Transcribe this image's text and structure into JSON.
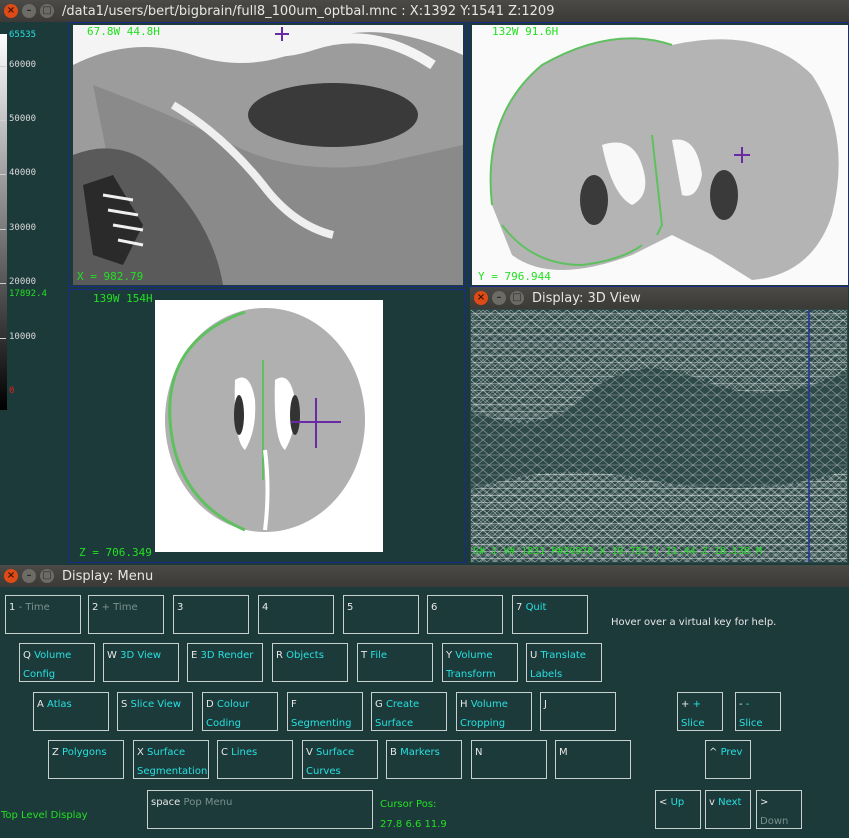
{
  "main_window": {
    "title": "/data1/users/bert/bigbrain/full8_100um_optbal.mnc : X:1392 Y:1541 Z:1209",
    "buttons": [
      "×",
      "–",
      "□"
    ]
  },
  "colorbar": {
    "labels": [
      "65535",
      "60000",
      "50000",
      "40000",
      "30000",
      "20000",
      "17892.4",
      "10000",
      "0"
    ]
  },
  "views": {
    "sagittal": {
      "dims": "67.8W  44.8H",
      "coord": "X =  982.79"
    },
    "coronal": {
      "dims": "132W  91.6H",
      "coord": "Y =  796.944"
    },
    "axial": {
      "dims": "139W  154H",
      "coord": "Z =  706.349"
    }
  },
  "view3d": {
    "title": "Display: 3D View",
    "buttons": [
      "×",
      "–",
      "□"
    ],
    "status": "S# 1 V# 1831 P#20970 X 19.752 Y 11.44 Z 18.138 M"
  },
  "menu": {
    "title": "Display: Menu",
    "buttons": [
      "×",
      "–",
      "□"
    ],
    "help": "Hover over a virtual key for help.",
    "top_level": "Top Level Display",
    "cursor_label": "Cursor Pos:",
    "cursor_value": "27.8 6.6 11.9",
    "keys": {
      "k1": {
        "key": "1",
        "l1": "- Time",
        "l2": ""
      },
      "k2": {
        "key": "2",
        "l1": "+ Time",
        "l2": ""
      },
      "k3": {
        "key": "3",
        "l1": "",
        "l2": ""
      },
      "k4": {
        "key": "4",
        "l1": "",
        "l2": ""
      },
      "k5": {
        "key": "5",
        "l1": "",
        "l2": ""
      },
      "k6": {
        "key": "6",
        "l1": "",
        "l2": ""
      },
      "k7": {
        "key": "7",
        "l1": "Quit",
        "l2": ""
      },
      "kq": {
        "key": "Q",
        "l1": "Volume",
        "l2": "Config"
      },
      "kw": {
        "key": "W",
        "l1": "3D View",
        "l2": ""
      },
      "ke": {
        "key": "E",
        "l1": "3D Render",
        "l2": ""
      },
      "kr": {
        "key": "R",
        "l1": "Objects",
        "l2": ""
      },
      "kt": {
        "key": "T",
        "l1": "File",
        "l2": ""
      },
      "ky": {
        "key": "Y",
        "l1": "Volume",
        "l2": "Transform"
      },
      "ku": {
        "key": "U",
        "l1": "Translate",
        "l2": "Labels"
      },
      "ka": {
        "key": "A",
        "l1": "Atlas",
        "l2": ""
      },
      "ks": {
        "key": "S",
        "l1": "Slice View",
        "l2": ""
      },
      "kd": {
        "key": "D",
        "l1": "Colour",
        "l2": "Coding"
      },
      "kf": {
        "key": "F",
        "l1": "Segmenting",
        "l2": ""
      },
      "kg": {
        "key": "G",
        "l1": "Create",
        "l2": "Surface"
      },
      "kh": {
        "key": "H",
        "l1": "Volume",
        "l2": "Cropping"
      },
      "kj": {
        "key": "J",
        "l1": "",
        "l2": ""
      },
      "kplus": {
        "key": "+",
        "l1": "+",
        "l2": "Slice"
      },
      "kminus": {
        "key": "-",
        "l1": "-",
        "l2": "Slice"
      },
      "kz": {
        "key": "Z",
        "l1": "Polygons",
        "l2": ""
      },
      "kx": {
        "key": "X",
        "l1": "Surface",
        "l2": "Segmentation"
      },
      "kc": {
        "key": "C",
        "l1": "Lines",
        "l2": ""
      },
      "kv": {
        "key": "V",
        "l1": "Surface",
        "l2": "Curves"
      },
      "kb": {
        "key": "B",
        "l1": "Markers",
        "l2": ""
      },
      "kn": {
        "key": "N",
        "l1": "",
        "l2": ""
      },
      "km": {
        "key": "M",
        "l1": "",
        "l2": ""
      },
      "kprev": {
        "key": "^",
        "l1": "Prev",
        "l2": ""
      },
      "kspace": {
        "key": "space",
        "l1": "Pop Menu",
        "l2": ""
      },
      "kup": {
        "key": "<",
        "l1": "Up",
        "l2": ""
      },
      "knext": {
        "key": "v",
        "l1": "Next",
        "l2": ""
      },
      "kdown": {
        "key": ">",
        "l1": "Down",
        "l2": ""
      }
    }
  },
  "colors": {
    "background": "#1d3a3a",
    "label_cyan": "#26e0e0",
    "text_green": "#22e022",
    "cursor_purple": "#6a2aa6",
    "contour_green": "#5fc05f"
  }
}
